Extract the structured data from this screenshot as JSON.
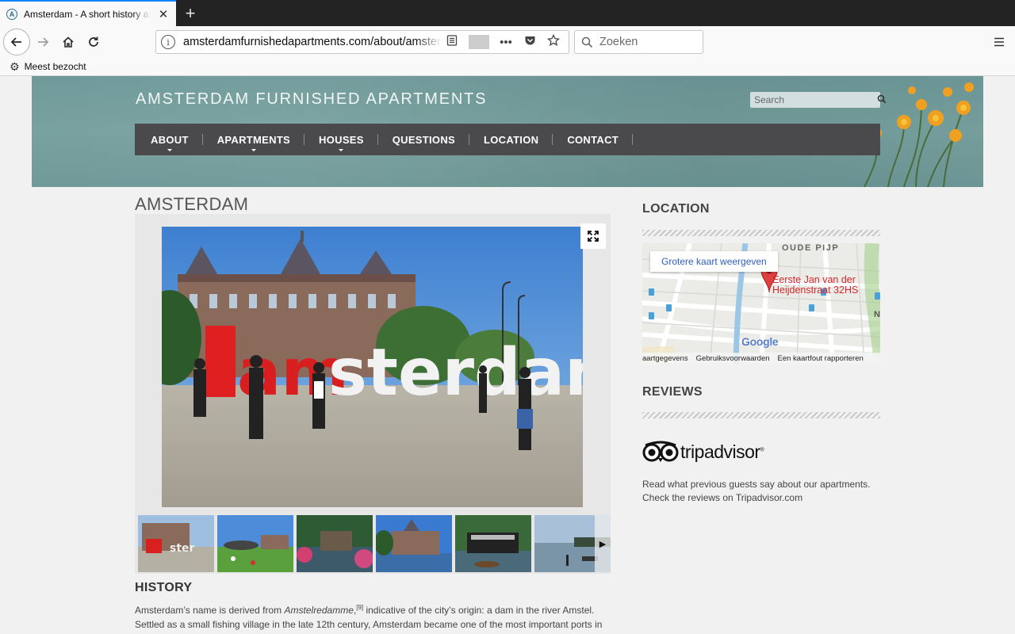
{
  "browser": {
    "tab_title": "Amsterdam - A short history and",
    "favicon_letter": "A",
    "tab_close": "✕",
    "new_tab": "+",
    "url": "amsterdamfurnishedapartments.com/about/amsterdam/",
    "search_placeholder": "Zoeken",
    "bookmark_label": "Meest bezocht"
  },
  "site": {
    "title": "AMSTERDAM FURNISHED APARTMENTS",
    "search_placeholder": "Search",
    "nav": [
      {
        "label": "ABOUT",
        "has_submenu": true
      },
      {
        "label": "APARTMENTS",
        "has_submenu": true
      },
      {
        "label": "HOUSES",
        "has_submenu": true
      },
      {
        "label": "QUESTIONS",
        "has_submenu": false
      },
      {
        "label": "LOCATION",
        "has_submenu": false
      },
      {
        "label": "CONTACT",
        "has_submenu": false
      }
    ]
  },
  "main": {
    "page_title": "AMSTERDAM",
    "gallery": {
      "main_caption": "I amsterdam",
      "thumb_count": 6
    },
    "history": {
      "title": "HISTORY",
      "p1_a": "Amsterdam’s name is derived from ",
      "p1_em": "Amstelredamme",
      "p1_sup": "[9]",
      "p1_b": " indicative of the city’s origin: a dam in the river ",
      "p1_link": "Amstel",
      "p1_c": ". Settled as a small fishing village in the late 12th century, Amsterdam became one of the most important ports in the world during the Dutch Golden Age, a result of its innovative developments in trade. During that time, the city"
    }
  },
  "sidebar": {
    "location_title": "LOCATION",
    "map_link": "Grotere kaart weergeven",
    "map_marker_label_1": "Eerste Jan van der",
    "map_marker_label_2": "Heijdenstraat 32HS",
    "map_district": "OUDE PIJP",
    "map_n": "N",
    "map_google": "Google",
    "map_footer_1": "aartgegevens",
    "map_footer_2": "Gebruiksvoorwaarden",
    "map_footer_3": "Een kaartfout rapporteren",
    "reviews_title": "REVIEWS",
    "ta_brand": "tripadvisor",
    "ta_reg": "®",
    "reviews_text_1": "Read what previous guests say about our apartments.",
    "reviews_text_2a": "Check the reviews on ",
    "reviews_text_link": "Tripadvisor.com"
  },
  "colors": {
    "nav_bg": "#4a4a4c",
    "header_teal": "#76a09e",
    "map_pin": "#d6272a",
    "firefox_blue": "#0a84ff"
  }
}
